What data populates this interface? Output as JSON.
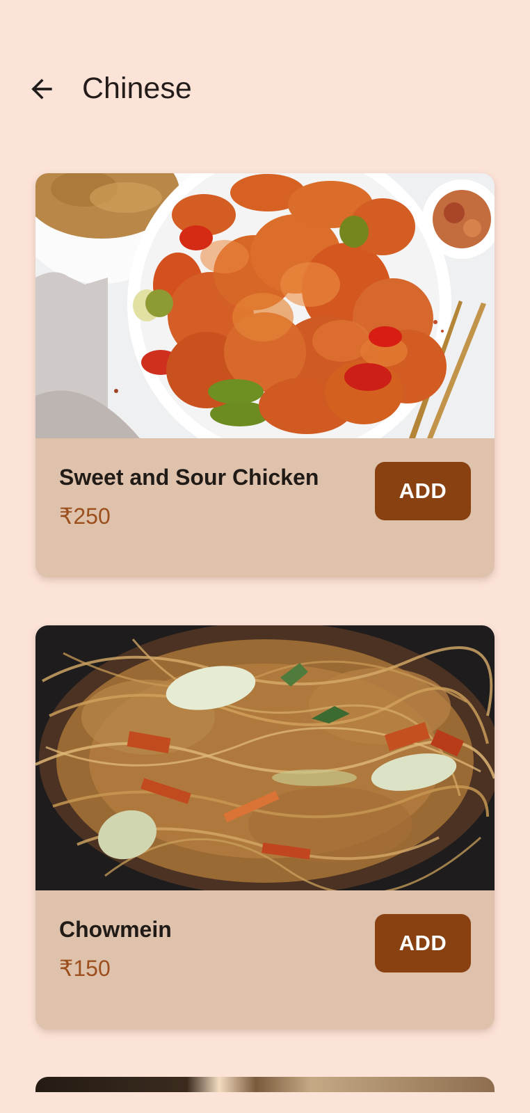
{
  "app_bar": {
    "title": "Chinese",
    "back_icon": "arrow-left-icon"
  },
  "menu": {
    "items": [
      {
        "name": "Sweet and Sour Chicken",
        "price": "₹250",
        "button_label": "ADD",
        "image": "sweet-and-sour-chicken-photo"
      },
      {
        "name": "Chowmein",
        "price": "₹150",
        "button_label": "ADD",
        "image": "chowmein-photo"
      }
    ]
  },
  "colors": {
    "background": "#fbe3d8",
    "card": "#dfc2ac",
    "button": "#8a4112",
    "price": "#9b4f1c"
  }
}
